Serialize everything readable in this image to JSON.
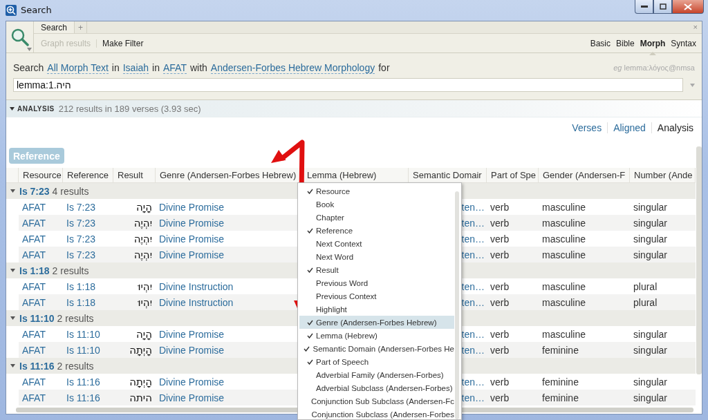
{
  "window": {
    "title": "Search"
  },
  "tabs": [
    {
      "label": "Search",
      "selected": true
    },
    {
      "label": "+",
      "selected": false
    }
  ],
  "tab_close": "×",
  "commands": [
    {
      "label": "Graph results",
      "disabled": true
    },
    {
      "label": "Make Filter",
      "disabled": false
    }
  ],
  "search_types": [
    {
      "label": "Basic",
      "selected": false
    },
    {
      "label": "Bible",
      "selected": false
    },
    {
      "label": "Morph",
      "selected": true
    },
    {
      "label": "Syntax",
      "selected": false
    }
  ],
  "query": {
    "parts": [
      {
        "kind": "text",
        "text": "Search"
      },
      {
        "kind": "link",
        "text": "All Morph Text"
      },
      {
        "kind": "text",
        "text": "in"
      },
      {
        "kind": "link",
        "text": "Isaiah"
      },
      {
        "kind": "text",
        "text": "in"
      },
      {
        "kind": "link",
        "text": "AFAT"
      },
      {
        "kind": "text",
        "text": "with"
      },
      {
        "kind": "link",
        "text": "Andersen-Forbes Hebrew Morphology"
      },
      {
        "kind": "text",
        "text": "for"
      }
    ],
    "hint": "*eg* lemma:λόγος@nmsa",
    "value": "lemma:1.היה"
  },
  "analysis": {
    "label": "ANALYSIS",
    "expanded": true,
    "summary": "212 results in 189 verses (3.93 sec)"
  },
  "views": [
    {
      "label": "Verses",
      "selected": false
    },
    {
      "label": "Aligned",
      "selected": false
    },
    {
      "label": "Analysis",
      "selected": true
    }
  ],
  "group_by": "Reference",
  "table": {
    "columns": [
      "Resource",
      "Reference",
      "Result",
      "Genre (Andersen-Forbes Hebrew)",
      "Lemma (Hebrew)",
      "Semantic Domair",
      "Part of Spe",
      "Gender (Andersen-F",
      "Number (Ande"
    ],
    "groups": [
      {
        "reference": "Is 7:23",
        "count": "4 results",
        "expanded": true,
        "rows": [
          {
            "resource": "AFAT",
            "reference": "Is 7:23",
            "result": "הָיָה",
            "genre": "Divine Promise",
            "semantic": "ten…",
            "part": "verb",
            "gender": "masculine",
            "number": "singular"
          },
          {
            "resource": "AFAT",
            "reference": "Is 7:23",
            "result": "יִהְיֶה",
            "genre": "Divine Promise",
            "semantic": "ten…",
            "part": "verb",
            "gender": "masculine",
            "number": "singular"
          },
          {
            "resource": "AFAT",
            "reference": "Is 7:23",
            "result": "יִהְיֶה",
            "genre": "Divine Promise",
            "semantic": "ten…",
            "part": "verb",
            "gender": "masculine",
            "number": "singular"
          },
          {
            "resource": "AFAT",
            "reference": "Is 7:23",
            "result": "יִהְיֶה",
            "genre": "Divine Promise",
            "semantic": "ten…",
            "part": "verb",
            "gender": "masculine",
            "number": "singular"
          }
        ]
      },
      {
        "reference": "Is 1:18",
        "count": "2 results",
        "expanded": true,
        "rows": [
          {
            "resource": "AFAT",
            "reference": "Is 1:18",
            "result": "יִהְיוּ",
            "genre": "Divine Instruction",
            "semantic": "ten…",
            "part": "verb",
            "gender": "masculine",
            "number": "plural"
          },
          {
            "resource": "AFAT",
            "reference": "Is 1:18",
            "result": "יִהְיוּ",
            "genre": "Divine Instruction",
            "semantic": "ten…",
            "part": "verb",
            "gender": "masculine",
            "number": "plural"
          }
        ]
      },
      {
        "reference": "Is 11:10",
        "count": "2 results",
        "expanded": true,
        "rows": [
          {
            "resource": "AFAT",
            "reference": "Is 11:10",
            "result": "הָיָה",
            "genre": "Divine Promise",
            "semantic": "ten…",
            "part": "verb",
            "gender": "masculine",
            "number": "singular"
          },
          {
            "resource": "AFAT",
            "reference": "Is 11:10",
            "result": "הָיְתָה",
            "genre": "Divine Promise",
            "semantic": "ten…",
            "part": "verb",
            "gender": "feminine",
            "number": "singular"
          }
        ]
      },
      {
        "reference": "Is 11:16",
        "count": "2 results",
        "expanded": true,
        "rows": [
          {
            "resource": "AFAT",
            "reference": "Is 11:16",
            "result": "הָיְתָה",
            "genre": "Divine Promise",
            "semantic": "ten…",
            "part": "verb",
            "gender": "feminine",
            "number": "singular"
          },
          {
            "resource": "AFAT",
            "reference": "Is 11:16",
            "result": "היתה",
            "genre": "Divine Promise",
            "semantic": "ten…",
            "part": "verb",
            "gender": "feminine",
            "number": "singular"
          }
        ]
      }
    ]
  },
  "column_menu": [
    {
      "label": "Resource",
      "checked": true,
      "selected": false
    },
    {
      "label": "Book",
      "checked": false,
      "selected": false
    },
    {
      "label": "Chapter",
      "checked": false,
      "selected": false
    },
    {
      "label": "Reference",
      "checked": true,
      "selected": false
    },
    {
      "label": "Next Context",
      "checked": false,
      "selected": false
    },
    {
      "label": "Next Word",
      "checked": false,
      "selected": false
    },
    {
      "label": "Result",
      "checked": true,
      "selected": false
    },
    {
      "label": "Previous Word",
      "checked": false,
      "selected": false
    },
    {
      "label": "Previous Context",
      "checked": false,
      "selected": false
    },
    {
      "label": "Highlight",
      "checked": false,
      "selected": false
    },
    {
      "label": "Genre (Andersen-Forbes Hebrew)",
      "checked": true,
      "selected": true
    },
    {
      "label": "Lemma (Hebrew)",
      "checked": true,
      "selected": false
    },
    {
      "label": "Semantic Domain (Andersen-Forbes He",
      "checked": true,
      "selected": false
    },
    {
      "label": "Part of Speech",
      "checked": true,
      "selected": false
    },
    {
      "label": "Adverbial Family (Andersen-Forbes)",
      "checked": false,
      "selected": false
    },
    {
      "label": "Adverbial Subclass (Andersen-Forbes)",
      "checked": false,
      "selected": false
    },
    {
      "label": "Conjunction Sub Subclass (Andersen-Fc",
      "checked": false,
      "selected": false
    },
    {
      "label": "Conjunction Subclass (Andersen-Forbes",
      "checked": false,
      "selected": false
    }
  ]
}
